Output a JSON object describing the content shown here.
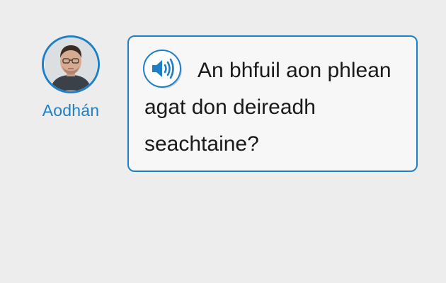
{
  "speaker": {
    "name": "Aodhán"
  },
  "message": {
    "text": "An bhfuil aon phlean agat don deireadh seachtaine?"
  },
  "colors": {
    "accent": "#1f7fc5",
    "bubble_background": "#f7f7f7",
    "page_background": "#ededed"
  },
  "icons": {
    "audio": "speaker-icon"
  }
}
